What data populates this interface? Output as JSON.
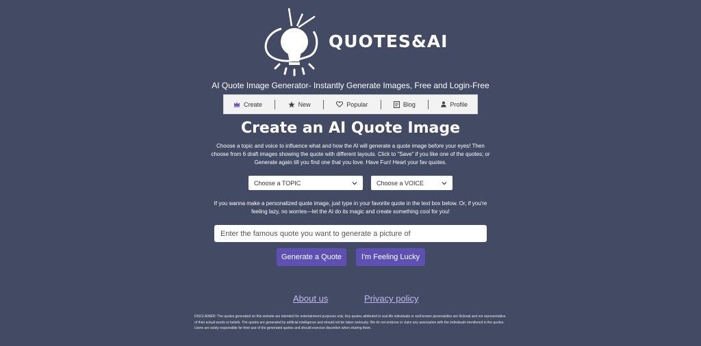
{
  "brand": {
    "name": "QUOTES&AI",
    "tagline": "AI Quote Image Generator- Instantly Generate Images, Free and Login-Free"
  },
  "nav": {
    "items": [
      {
        "label": "Create",
        "icon": "crown-icon"
      },
      {
        "label": "New",
        "icon": "star-icon"
      },
      {
        "label": "Popular",
        "icon": "heart-icon"
      },
      {
        "label": "Blog",
        "icon": "document-icon"
      },
      {
        "label": "Profile",
        "icon": "user-icon"
      }
    ]
  },
  "main": {
    "title": "Create an AI Quote Image",
    "intro": "Choose a topic and voice to influence what and how the AI will generate a quote image before your eyes! Then choose from 6 draft images showing the quote with different layouts. Click to \"Save\" if you like one of the quotes; or Generate again till you find one that you love. Have Fun! Heart your fav quotes.",
    "topic_select": "Choose a TOPIC",
    "voice_select": "Choose a VOICE",
    "personal_note": "If you wanna make a personalized quote image, just type in your favorite quote in the text box below. Or, if you're feeling lazy, no worries—let the AI do its magic and create something cool for you!",
    "input_placeholder": "Enter the famous quote you want to generate a picture of",
    "generate_button": "Generate a Quote",
    "lucky_button": "I'm Feeling Lucky"
  },
  "footer": {
    "about_link": "About us",
    "privacy_link": "Privacy policy",
    "disclaimer": "DISCLAIMER: The quotes generated on this website are intended for entertainment purposes only. Any quotes attributed to real-life individuals or well-known personalities are fictional and not representative of their actual words or beliefs. The quotes are generated by artificial intelligence and should not be taken seriously. We do not endorse or claim any association with the individuals mentioned in the quotes. Users are solely responsible for their use of the generated quotes and should exercise discretion when sharing them."
  },
  "colors": {
    "background": "#424b63",
    "button": "#5e4fb5",
    "link": "#c3b9f0",
    "nav_background": "#f2f2f2",
    "nav_icon_accent": "#6a4fc4"
  }
}
